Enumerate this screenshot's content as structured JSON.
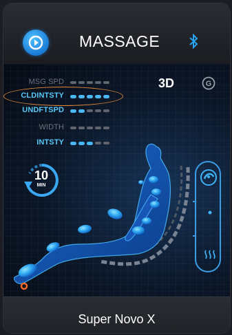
{
  "header": {
    "title": "MASSAGE",
    "play_icon": "play-circle-icon",
    "bluetooth_icon": "bluetooth-icon"
  },
  "params": [
    {
      "label": "MSG SPD",
      "level": 0,
      "max": 5,
      "state": "inactive"
    },
    {
      "label": "CLDINTSTY",
      "level": 5,
      "max": 5,
      "state": "selected"
    },
    {
      "label": "UNDFTSPD",
      "level": 2,
      "max": 5,
      "state": "active"
    },
    {
      "label": "WIDTH",
      "level": 0,
      "max": 5,
      "state": "inactive"
    },
    {
      "label": "INTSTY",
      "level": 3,
      "max": 5,
      "state": "active"
    }
  ],
  "mode_label": "3D",
  "g_icon": "g-circle-icon",
  "timer": {
    "value": "10",
    "unit": "MIN",
    "icon": "countdown-arrow-icon"
  },
  "colors": {
    "accent": "#4ab8f2",
    "highlight": "#e0893a",
    "inactive": "#5f646d"
  },
  "side_panel_icons": [
    "shoulder-position-icon",
    "center-dot-icon",
    "heat-icon"
  ],
  "footer": {
    "name": "Super Novo X"
  }
}
